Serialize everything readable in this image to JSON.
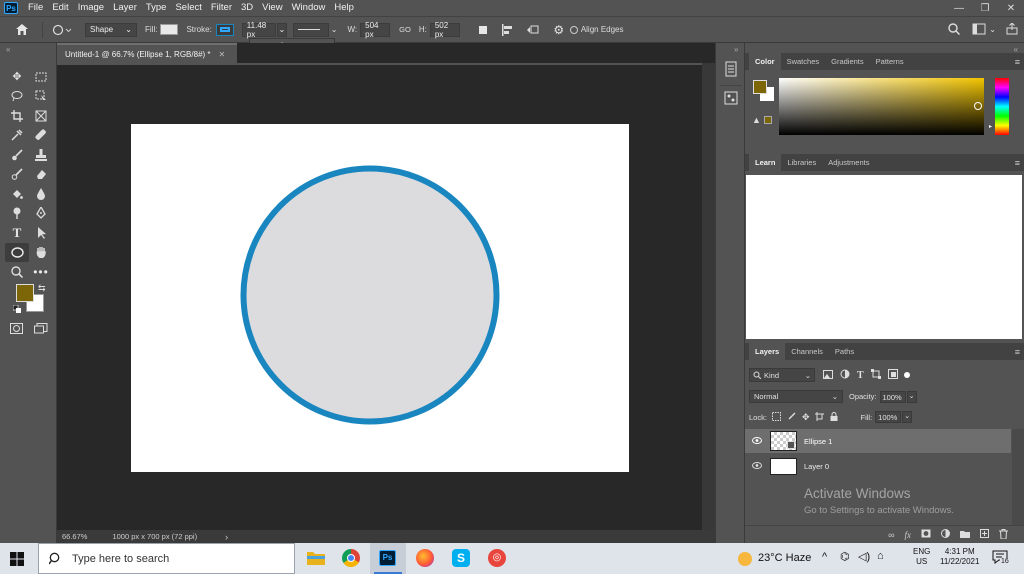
{
  "app": {
    "logo": "Ps",
    "menu": [
      "File",
      "Edit",
      "Image",
      "Layer",
      "Type",
      "Select",
      "Filter",
      "3D",
      "View",
      "Window",
      "Help"
    ],
    "window_controls": [
      "—",
      "❐",
      "✕"
    ]
  },
  "options": {
    "tool_mode": "Shape",
    "fill_label": "Fill:",
    "stroke_label": "Stroke:",
    "stroke_width": "11.48 px",
    "w_label": "W:",
    "width": "504 px",
    "link_label": "GO",
    "h_label": "H:",
    "height": "502 px",
    "align_edges": "Align Edges"
  },
  "document": {
    "tab_title": "Untitled-1 @ 66.7% (Ellipse 1, RGB/8#) *",
    "zoom": "66.67%",
    "doc_info": "1000 px x 700 px (72 ppi)",
    "status_arrow": "›"
  },
  "color_panel": {
    "tabs": [
      "Color",
      "Swatches",
      "Gradients",
      "Patterns"
    ],
    "foreground": "#7d6608",
    "hue": "#f2c400"
  },
  "learn_panel": {
    "tabs": [
      "Learn",
      "Libraries",
      "Adjustments"
    ]
  },
  "layers_panel": {
    "tabs": [
      "Layers",
      "Channels",
      "Paths"
    ],
    "filter_kind": "Kind",
    "blend_mode": "Normal",
    "opacity_label": "Opacity:",
    "opacity": "100%",
    "lock_label": "Lock:",
    "fill_label": "Fill:",
    "fill": "100%",
    "layers": [
      {
        "name": "Ellipse 1",
        "selected": true
      },
      {
        "name": "Layer 0",
        "selected": false
      }
    ]
  },
  "watermark": {
    "line1": "Activate Windows",
    "line2": "Go to Settings to activate Windows."
  },
  "taskbar": {
    "search_placeholder": "Type here to search",
    "weather": "23°C  Haze",
    "language": "ENG",
    "region": "US",
    "time": "4:31 PM",
    "date": "11/22/2021",
    "notification_count": "16"
  },
  "colors": {
    "stroke": "#1a86c0",
    "shape_fill": "#dcdcde",
    "accent": "#31a8ff"
  }
}
